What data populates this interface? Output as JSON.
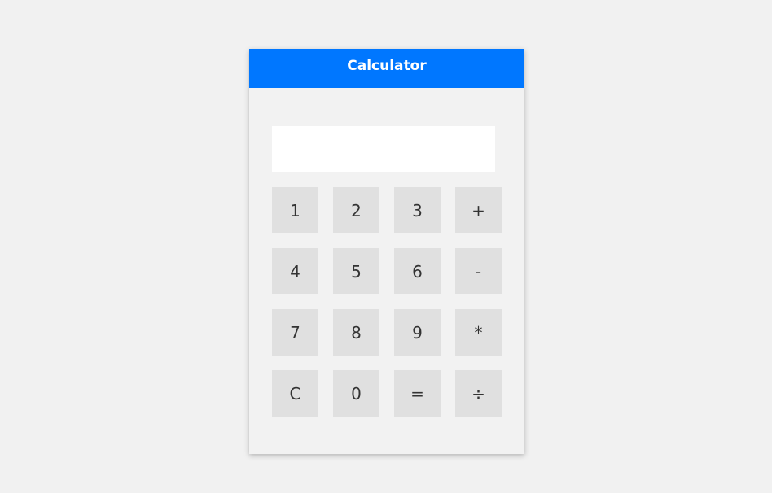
{
  "calculator": {
    "title": "Calculator",
    "display_value": "",
    "header_color": "#0077ff",
    "keys": [
      {
        "label": "1",
        "name": "key-1"
      },
      {
        "label": "2",
        "name": "key-2"
      },
      {
        "label": "3",
        "name": "key-3"
      },
      {
        "label": "+",
        "name": "key-add"
      },
      {
        "label": "4",
        "name": "key-4"
      },
      {
        "label": "5",
        "name": "key-5"
      },
      {
        "label": "6",
        "name": "key-6"
      },
      {
        "label": "-",
        "name": "key-subtract"
      },
      {
        "label": "7",
        "name": "key-7"
      },
      {
        "label": "8",
        "name": "key-8"
      },
      {
        "label": "9",
        "name": "key-9"
      },
      {
        "label": "*",
        "name": "key-multiply"
      },
      {
        "label": "C",
        "name": "key-clear"
      },
      {
        "label": "0",
        "name": "key-0"
      },
      {
        "label": "=",
        "name": "key-equals"
      },
      {
        "label": "÷",
        "name": "key-divide"
      }
    ]
  }
}
